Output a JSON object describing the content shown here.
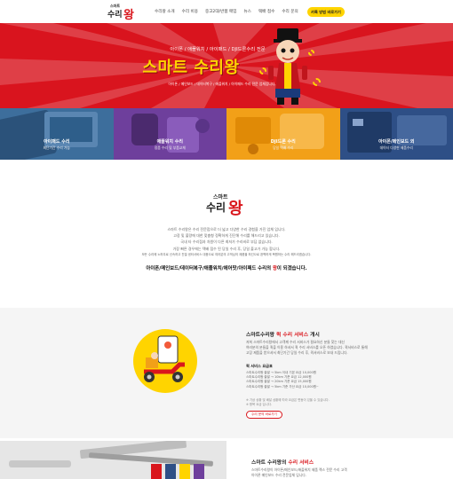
{
  "header": {
    "logo_top": "스마트",
    "logo_main": "수리",
    "logo_accent": "왕",
    "nav": [
      "수리왕 소개",
      "수리 비용",
      "중고2대/반품 매입",
      "뉴스",
      "택배 접수",
      "수리 문의"
    ],
    "cta": "카톡 방범 바로가기"
  },
  "hero": {
    "subtitle": "아이폰 / 애플워치 / 아이패드 / DJI드론수리 전문",
    "title": "스마트 수리왕",
    "tags_prefix": "아이폰 / 메인보드 / 데이터복구 / 애플워치 / 아이패드 수리 전문 업체입니다.",
    "colors": {
      "bg": "#d9141e",
      "accent": "#ffd400"
    }
  },
  "cards": [
    {
      "title": "아이패드 수리",
      "sub": "최단기간 수리 가능",
      "color": "#3d6e9c"
    },
    {
      "title": "애플워치 수리",
      "sub": "정품 수리 및 부품교체",
      "color": "#6e3f9c"
    },
    {
      "title": "DJI드론 수리",
      "sub": "당일 택배 수리",
      "color": "#f2a018"
    },
    {
      "title": "아이폰/메인보드 외",
      "sub": "데이터 다양한 제품수리",
      "color": "#2e4f86"
    }
  ],
  "about": {
    "logo_top": "스마트",
    "logo_main": "수리",
    "logo_accent": "왕",
    "lines": [
      "스마트 수리왕은 수리 전문점으로 더 넓고 다양한 수리 경험을 가진 업체 입니다.",
      "고장 및 불량에 대한 맞춤형 정확하게 진단해 수리를 해드리고 있습니다.",
      "국내 타 수리점과 차원이 다른 최저가 수리비로 부담 없습니다.",
      "가장 빠른 경우에는 택배 접수 된 당일 수리 후, 당일 출고가 가능 합니다.",
      "모든 수리에 노하우로 신속하고 친절 센터서비스 대응으로 여러분의 고객님의 제품을 최선으로 완벽하게 복원하는 수리 해드리겠습니다."
    ],
    "strong_prefix": "아이폰/메인보드/데이터복구/애플워치/에어팟/아이패드 수리의",
    "strong_accent": "왕",
    "strong_suffix": "이 되겠습니다."
  },
  "service": {
    "title_prefix": "스마트수리왕",
    "title_accent": "퀵 수리 서비스",
    "title_suffix": "개시",
    "desc": [
      "저희 스마트수리왕에서 고객께 수리 서비스가 필요하신 분들 찾는 대신",
      "여러분의 분들을 퀵을 이용 하셔서 퀵 수리 서비스를 오픈 하였습니다. 퀵서비스로 통해",
      "고장 제품을 받으셔서 최단기간 당일 수리 후, 퀵서비스로 보내 드립니다."
    ],
    "fee_head": "퀵 서비스 요금표",
    "fees": [
      "스마트수리왕 출발 → 5km 이내 기본 요금 10,000원",
      "스마트수리왕 출발 → 10km 기준 요금 12,000원",
      "스마트수리왕 출발 → 20km 기준 요금 15,000원",
      "스마트수리왕 출발 → 5km 기준 가산 요금 10,000원~"
    ],
    "notes": [
      "※ 기상 상황 및 배달 상황에 따라 요금은 변동이 있을 수 있습니다.",
      "※ 왕복 요금 입니다."
    ],
    "button": "수리 문의 바로가기"
  },
  "bottom": {
    "title_prefix": "스마트 수리왕의",
    "title_accent": "수리 서비스",
    "desc": [
      "스마트수리왕이 아이폰/메인보드/애플워치 제품 렉스 전문 수리 고객",
      "아이폰 메인보드 수리 전문업체 입니다."
    ]
  }
}
